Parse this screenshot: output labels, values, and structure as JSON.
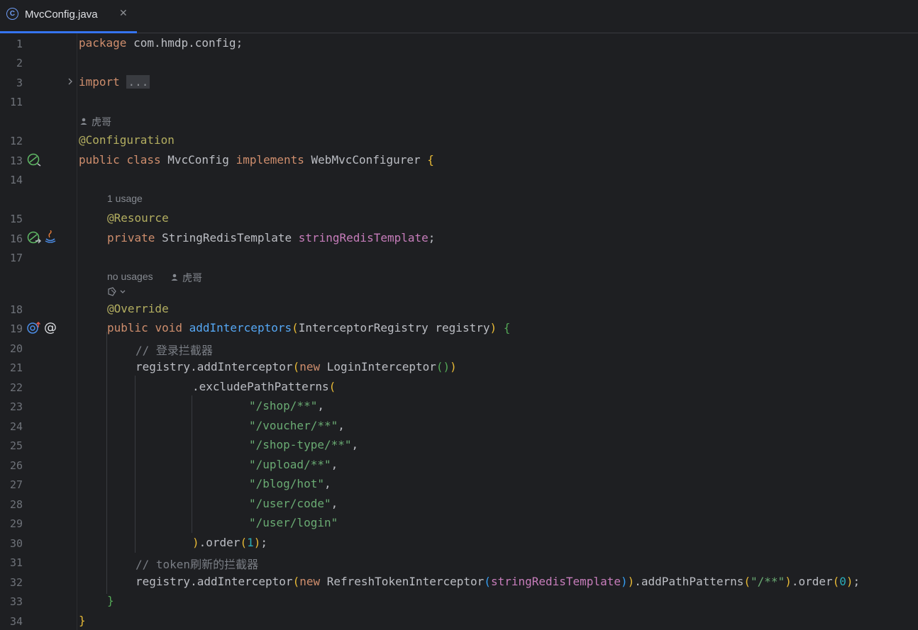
{
  "tab": {
    "title": "MvcConfig.java",
    "icon": "class-c-icon",
    "close": "✕"
  },
  "lines": {
    "l1": "1",
    "l2": "2",
    "l3": "3",
    "l11": "11",
    "l12": "12",
    "l13": "13",
    "l14": "14",
    "l15": "15",
    "l16": "16",
    "l17": "17",
    "l18": "18",
    "l19": "19",
    "l20": "20",
    "l21": "21",
    "l22": "22",
    "l23": "23",
    "l24": "24",
    "l25": "25",
    "l26": "26",
    "l27": "27",
    "l28": "28",
    "l29": "29",
    "l30": "30",
    "l31": "31",
    "l32": "32",
    "l33": "33",
    "l34": "34"
  },
  "hints": {
    "author1": "虎哥",
    "usage1": "1 usage",
    "usage2": "no usages",
    "author2": "虎哥"
  },
  "code": {
    "pkg_kw": "package",
    "pkg_name": " com.hmdp.config;",
    "import_kw": "import",
    "import_fold": "...",
    "ann_config": "@Configuration",
    "class_public": "public",
    "class_class": "class",
    "class_name": " MvcConfig ",
    "class_impl": "implements",
    "class_iface": " WebMvcConfigurer ",
    "brace_open": "{",
    "ann_resource": "@Resource",
    "f_private": "private",
    "f_type": " StringRedisTemplate ",
    "f_name": "stringRedisTemplate",
    "semi": ";",
    "ann_override": "@Override",
    "m_public": "public",
    "m_void": "void",
    "m_name": "addInterceptors",
    "m_params": "InterceptorRegistry registry",
    "c1": "// 登录拦截器",
    "r1_pre": "registry.addInterceptor",
    "new": "new",
    "r1_cls": " LoginInterceptor",
    "excl": ".excludePathPatterns",
    "s1": "\"/shop/**\"",
    "s2": "\"/voucher/**\"",
    "s3": "\"/shop-type/**\"",
    "s4": "\"/upload/**\"",
    "s5": "\"/blog/hot\"",
    "s6": "\"/user/code\"",
    "s7": "\"/user/login\"",
    "comma": ",",
    "order": ".order",
    "n1": "1",
    "n0": "0",
    "c2": "// token刷新的拦截器",
    "r2_cls": " RefreshTokenInterceptor",
    "r2_add": ".addPathPatterns",
    "s8": "\"/**\""
  },
  "colors": {
    "background": "#1e1f22",
    "keyword": "#cf8e6d",
    "annotation": "#b3ae60",
    "string": "#6aab73",
    "number": "#2aacb8",
    "field": "#c77dbb",
    "method": "#56a8f5",
    "comment": "#7a7e85",
    "accent": "#3574f0"
  }
}
